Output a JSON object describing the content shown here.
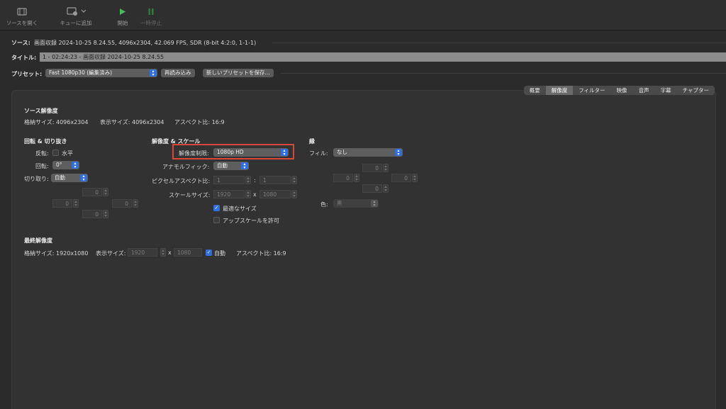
{
  "toolbar": {
    "open_source": "ソースを開く",
    "add_to_queue": "キューに追加",
    "start": "開始",
    "pause": "一時停止"
  },
  "source": {
    "label": "ソース:",
    "value": "画面収録 2024-10-25 8.24.55, 4096x2304, 42.069 FPS, SDR (8-bit 4:2:0, 1-1-1)"
  },
  "title": {
    "label": "タイトル:",
    "value": "1 - 02:24:23 - 画面収録 2024-10-25 8.24.55"
  },
  "preset": {
    "label": "プリセット:",
    "value": "Fast 1080p30 (編集済み)",
    "reload": "再読み込み",
    "save_new": "新しいプリセットを保存..."
  },
  "tabs": [
    "概要",
    "解像度",
    "フィルター",
    "映像",
    "音声",
    "字幕",
    "チャプター"
  ],
  "selected_tab": "解像度",
  "source_resolution": {
    "heading": "ソース解像度",
    "storage": "格納サイズ: 4096x2304",
    "display": "表示サイズ: 4096x2304",
    "aspect": "アスペクト比: 16:9"
  },
  "rotate_crop": {
    "heading": "回転 & 切り抜き",
    "flip_label": "反転:",
    "flip_option": "水平",
    "rotate_label": "回転:",
    "rotate_value": "0°",
    "crop_label": "切り取り:",
    "crop_value": "自動",
    "crop_top": "0",
    "crop_left": "0",
    "crop_right": "0",
    "crop_bottom": "0"
  },
  "resolution_scale": {
    "heading": "解像度 & スケール",
    "limit_label": "解像度制限:",
    "limit_value": "1080p HD",
    "anamorphic_label": "アナモルフィック:",
    "anamorphic_value": "自動",
    "pixel_aspect_label": "ピクセルアスペクト比:",
    "pixel_aspect_w": "1",
    "pixel_aspect_sep": ":",
    "pixel_aspect_h": "1",
    "scale_label": "スケールサイズ:",
    "scale_w": "1920",
    "scale_x": "x",
    "scale_h": "1080",
    "optimal_size": "最適なサイズ",
    "allow_upscale": "アップスケールを許可"
  },
  "border": {
    "heading": "縁",
    "fill_label": "フィル:",
    "fill_value": "なし",
    "top": "0",
    "left": "0",
    "right": "0",
    "bottom": "0",
    "color_label": "色:",
    "color_value": "黒"
  },
  "final_resolution": {
    "heading": "最終解像度",
    "storage": "格納サイズ: 1920x1080",
    "display_label": "表示サイズ:",
    "display_w": "1920",
    "display_x": "x",
    "display_h": "1080",
    "auto": "自動",
    "aspect": "アスペクト比: 16:9"
  },
  "colors": {
    "accent": "#2f6fe0",
    "highlight": "#d8473a",
    "play": "#3ec15a",
    "pause": "#2f7a3e"
  }
}
